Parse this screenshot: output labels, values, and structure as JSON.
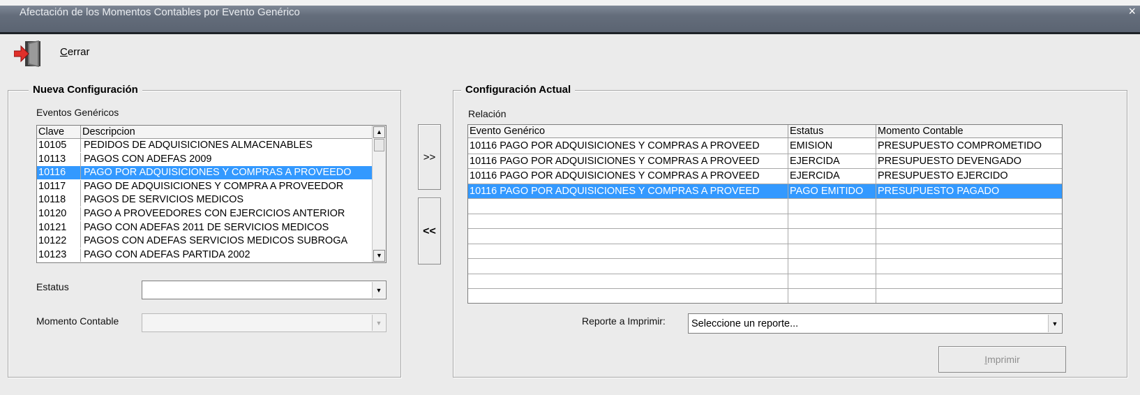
{
  "window": {
    "title": "Afectación de los Momentos Contables por Evento Genérico",
    "close_glyph": "×"
  },
  "toolbar": {
    "cerrar_mnemonic": "C",
    "cerrar_rest": "errar",
    "exit_icon": "exit-door-icon"
  },
  "nueva": {
    "group_title": "Nueva Configuración",
    "list_label": "Eventos Genéricos",
    "columns": [
      "Clave",
      "Descripcion"
    ],
    "rows": [
      {
        "clave": "10105",
        "desc": "PEDIDOS DE ADQUISICIONES ALMACENABLES"
      },
      {
        "clave": "10113",
        "desc": "PAGOS CON ADEFAS 2009"
      },
      {
        "clave": "10116",
        "desc": "PAGO POR ADQUISICIONES Y COMPRAS A PROVEEDO"
      },
      {
        "clave": "10117",
        "desc": "PAGO DE ADQUISICIONES Y COMPRA A PROVEEDOR"
      },
      {
        "clave": "10118",
        "desc": "PAGOS DE SERVICIOS MEDICOS"
      },
      {
        "clave": "10120",
        "desc": "PAGO A PROVEEDORES CON EJERCICIOS ANTERIOR"
      },
      {
        "clave": "10121",
        "desc": "PAGO CON ADEFAS 2011 DE SERVICIOS MEDICOS"
      },
      {
        "clave": "10122",
        "desc": "PAGOS CON ADEFAS  SERVICIOS MEDICOS SUBROGA"
      },
      {
        "clave": "10123",
        "desc": "PAGO CON ADEFAS PARTIDA 2002"
      }
    ],
    "selected_index": 2,
    "estatus_label": "Estatus",
    "estatus_value": "",
    "momento_label": "Momento Contable",
    "momento_value": ""
  },
  "transfer": {
    "add_label": ">>",
    "remove_label": "<<"
  },
  "actual": {
    "group_title": "Configuración Actual",
    "grid_label": "Relación",
    "columns": [
      "Evento Genérico",
      "Estatus",
      "Momento Contable"
    ],
    "rows": [
      {
        "evento": "10116 PAGO POR ADQUISICIONES Y COMPRAS A PROVEED",
        "estatus": "EMISION",
        "momento": "PRESUPUESTO COMPROMETIDO"
      },
      {
        "evento": "10116 PAGO POR ADQUISICIONES Y COMPRAS A PROVEED",
        "estatus": "EJERCIDA",
        "momento": "PRESUPUESTO DEVENGADO"
      },
      {
        "evento": "10116 PAGO POR ADQUISICIONES Y COMPRAS A PROVEED",
        "estatus": "EJERCIDA",
        "momento": "PRESUPUESTO EJERCIDO"
      },
      {
        "evento": "10116 PAGO POR ADQUISICIONES Y COMPRAS A PROVEED",
        "estatus": "PAGO EMITIDO",
        "momento": "PRESUPUESTO PAGADO"
      }
    ],
    "selected_index": 3,
    "reporte_label": "Reporte a Imprimir:",
    "reporte_value": "Seleccione un reporte...",
    "imprimir_mnemonic": "I",
    "imprimir_rest": "mprimir"
  },
  "colors": {
    "selection": "#3399ff",
    "window_bg": "#ebebeb",
    "titlebar": "#646d7b"
  }
}
